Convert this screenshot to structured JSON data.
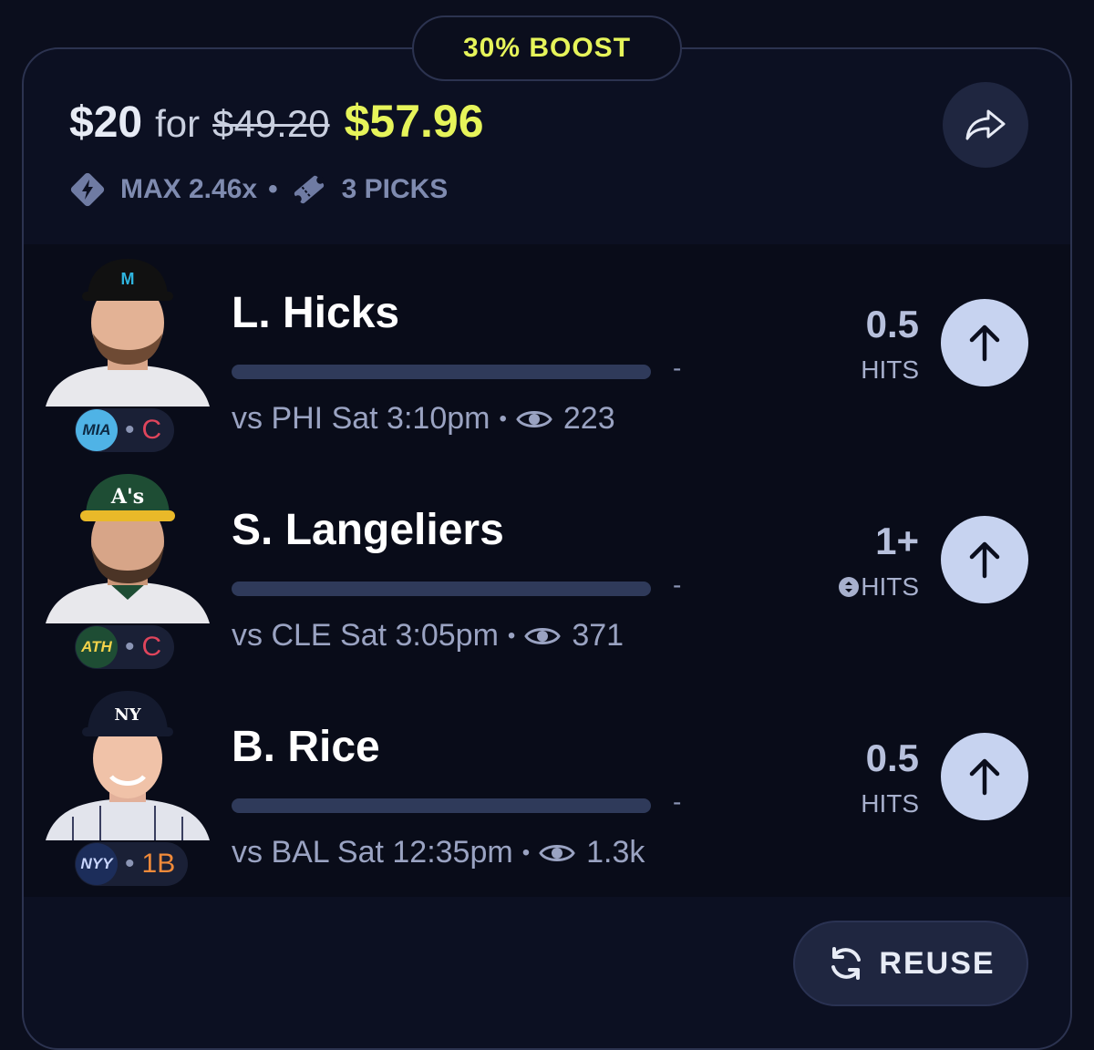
{
  "boost_label": "30% BOOST",
  "header": {
    "stake": "$20",
    "for_text": "for",
    "old_payout": "$49.20",
    "new_payout": "$57.96",
    "max_multiplier": "MAX 2.46x",
    "separator": "•",
    "picks_count": "3 PICKS",
    "share_icon": "share-arrow-icon"
  },
  "picks": [
    {
      "player": "L. Hicks",
      "team": "MIA",
      "position": "C",
      "team_color": "#4fb3e6",
      "pos_color": "#e0455c",
      "game": "vs PHI Sat 3:10pm",
      "views": "223",
      "line": "0.5",
      "stat": "HITS",
      "dash": "-",
      "direction": "up"
    },
    {
      "player": "S. Langeliers",
      "team": "ATH",
      "position": "C",
      "team_color": "#1e4d34",
      "pos_color": "#e0455c",
      "game": "vs CLE Sat 3:05pm",
      "views": "371",
      "line": "1+",
      "stat": "HITS",
      "dash": "-",
      "direction": "up"
    },
    {
      "player": "B. Rice",
      "team": "NYY",
      "position": "1B",
      "team_color": "#1c2d5a",
      "pos_color": "#f08a3a",
      "game": "vs BAL Sat 12:35pm",
      "views": "1.3k",
      "line": "0.5",
      "stat": "HITS",
      "dash": "-",
      "direction": "up"
    }
  ],
  "footer": {
    "reuse_label": "REUSE"
  }
}
